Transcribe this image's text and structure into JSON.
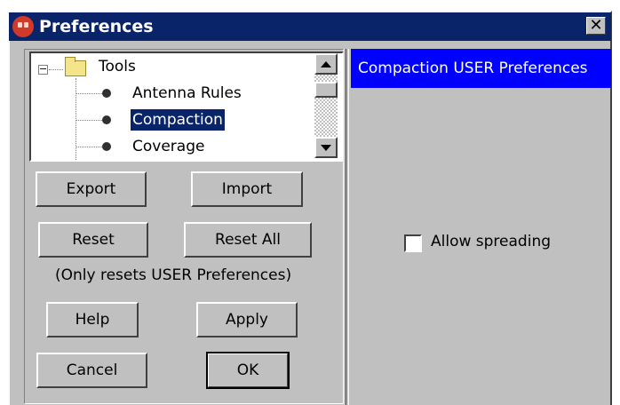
{
  "window": {
    "title": "Preferences",
    "close_glyph": "✕"
  },
  "tree": {
    "items": [
      {
        "label": "Tools",
        "type": "folder",
        "expander": "⊟"
      },
      {
        "label": "Antenna Rules",
        "type": "leaf"
      },
      {
        "label": "Compaction",
        "type": "leaf",
        "selected": true
      },
      {
        "label": "Coverage",
        "type": "leaf"
      }
    ]
  },
  "buttons": {
    "export": "Export",
    "import": "Import",
    "reset": "Reset",
    "reset_all": "Reset All",
    "help": "Help",
    "apply": "Apply",
    "cancel": "Cancel",
    "ok": "OK"
  },
  "note": "(Only resets USER Preferences)",
  "right": {
    "header": "Compaction USER Preferences",
    "checkbox_label": "Allow spreading",
    "checkbox_checked": false
  },
  "colors": {
    "titlebar": "#0a246a",
    "panel_header": "#0000ff",
    "face": "#c0c0c0"
  }
}
